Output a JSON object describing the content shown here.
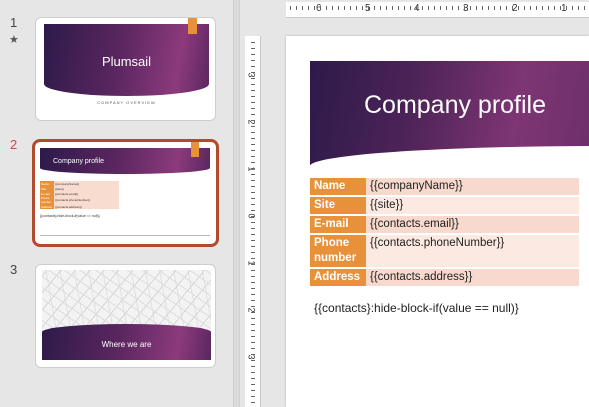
{
  "thumbnails": [
    {
      "number": "1",
      "title": "Plumsail",
      "subtitle": "COMPANY OVERVIEW"
    },
    {
      "number": "2",
      "title": "Company profile",
      "condition": "{{contacts}:hide-block-if(value == null)}"
    },
    {
      "number": "3",
      "title": "Where we are"
    }
  ],
  "slide": {
    "title": "Company profile",
    "rows": [
      {
        "key": "Name",
        "value": "{{companyName}}"
      },
      {
        "key": "Site",
        "value": "{{site}}"
      },
      {
        "key": "E-mail",
        "value": "{{contacts.email}}"
      },
      {
        "key": "Phone number",
        "value": "{{contacts.phoneNumber}}"
      },
      {
        "key": "Address",
        "value": "{{contacts.address}}"
      }
    ],
    "condition": "{{contacts}:hide-block-if(value == null)}"
  },
  "ruler": {
    "horizontal": [
      "6",
      "5",
      "4",
      "3",
      "2",
      "1"
    ],
    "vertical": [
      "3",
      "2",
      "1",
      "0",
      "1",
      "2",
      "3"
    ]
  },
  "colors": {
    "accent_orange": "#e8913b",
    "selection_border": "#b24a2e",
    "banner_purple": "#4d2358",
    "row_odd": "#f7d9cd",
    "row_even": "#fbe9e2"
  }
}
